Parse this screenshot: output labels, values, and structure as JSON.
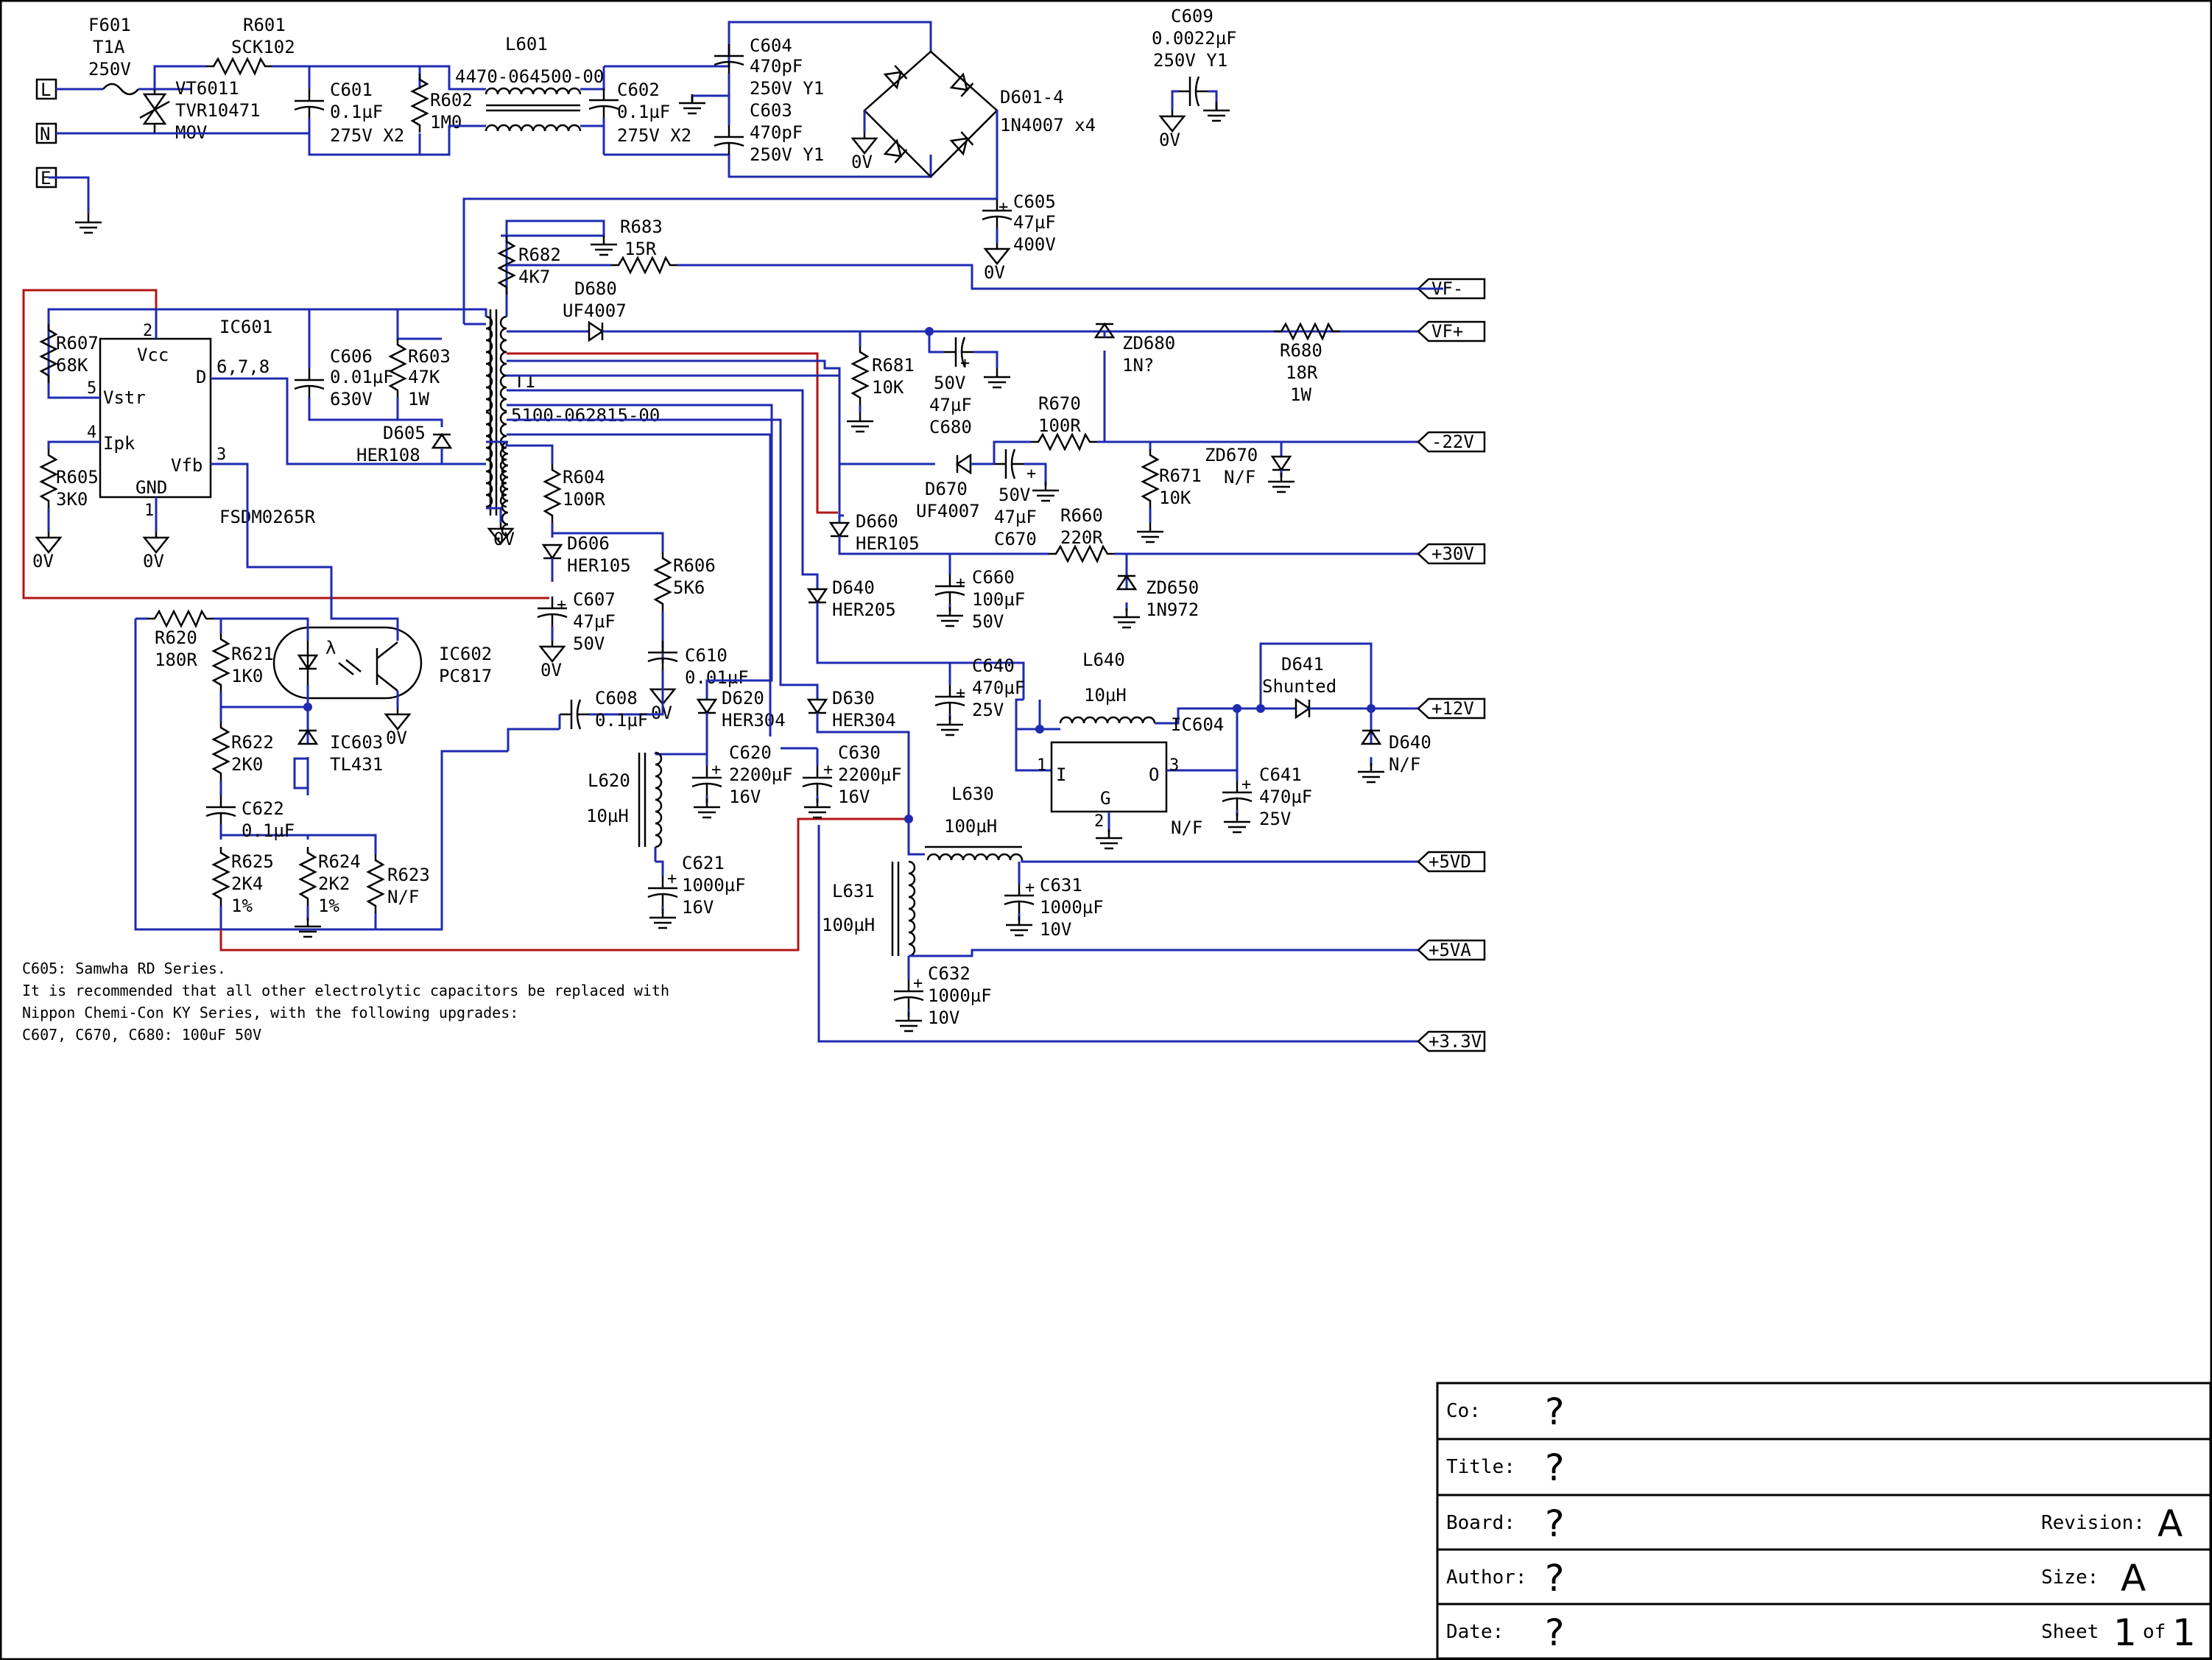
{
  "labels": {
    "f601": "F601",
    "f601_r": "T1A",
    "f601_v": "250V",
    "r601": "R601",
    "r601_v": "SCK102",
    "vt6011": "VT6011",
    "vt_type": "TVR10471",
    "vt_mov": "MOV",
    "c601": "C601",
    "c601_v": "0.1µF",
    "c601_r": "275V  X2",
    "r602": "R602",
    "r602_v": "1M0",
    "l601": "L601",
    "l601_pn": "4470-064500-00",
    "c602": "C602",
    "c602_v": "0.1µF",
    "c602_r": "275V  X2",
    "c604": "C604",
    "c604_v": "470pF",
    "c604_r": "250V  Y1",
    "c603": "C603",
    "c603_v": "470pF",
    "c603_r": "250V  Y1",
    "d601": "D601-4",
    "d601_v": "1N4007  x4",
    "c609": "C609",
    "c609_v": "0.0022µF",
    "c609_r": "250V  Y1",
    "c605": "C605",
    "c605_v": "47µF",
    "c605_r": "400V",
    "r683": "R683",
    "r683_v": "15R",
    "r682": "R682",
    "r682_v": "4K7",
    "d680": "D680",
    "d680_v": "UF4007",
    "ic601": "IC601",
    "ic601_type": "FSDM0265R",
    "pin_vcc": "Vcc",
    "pin_vstr": "Vstr",
    "pin_ipk": "Ipk",
    "pin_vfb": "Vfb",
    "pin_gnd": "GND",
    "pin_d": "D",
    "pin2": "2",
    "pin5": "5",
    "pin4": "4",
    "pin3": "3",
    "pin1": "1",
    "pin678": "6,7,8",
    "r607": "R607",
    "r607_v": "68K",
    "r605": "R605",
    "r605_v": "3K0",
    "c606": "C606",
    "c606_v": "0.01µF",
    "c606_r": "630V",
    "r603": "R603",
    "r603_v": "47K",
    "r603_r": "1W",
    "d605": "D605",
    "d605_v": "HER108",
    "t1": "T1",
    "t1_pn": "5100-062815-00",
    "r681": "R681",
    "r681_v": "10K",
    "c680": "C680",
    "c680_v": "47µF",
    "c680_r": "50V",
    "zd680": "ZD680",
    "zd680_v": "1N?",
    "r680": "R680",
    "r680_v": "18R",
    "r680_r": "1W",
    "r670": "R670",
    "r670_v": "100R",
    "d670": "D670",
    "d670_v": "UF4007",
    "c670": "C670",
    "c670_v": "47µF",
    "c670_r": "50V",
    "r671": "R671",
    "r671_v": "10K",
    "zd670": "ZD670",
    "zd670_v": "N/F",
    "r604": "R604",
    "r604_v": "100R",
    "d606": "D606",
    "d606_v": "HER105",
    "r606": "R606",
    "r606_v": "5K6",
    "c607": "C607",
    "c607_v": "47µF",
    "c607_r": "50V",
    "d660": "D660",
    "d660_v": "HER105",
    "r660": "R660",
    "r660_v": "220R",
    "d640": "D640",
    "d640_v": "HER205",
    "c660": "C660",
    "c660_v": "100µF",
    "c660_r": "50V",
    "zd650": "ZD650",
    "zd650_v": "1N972",
    "r620": "R620",
    "r620_v": "180R",
    "r621": "R621",
    "r621_v": "1K0",
    "ic602": "IC602",
    "ic602_v": "PC817",
    "c610": "C610",
    "c610_v": "0.01µF",
    "c608": "C608",
    "c608_v": "0.1µF",
    "d620": "D620",
    "d620_v": "HER304",
    "d630": "D630",
    "d630_v": "HER304",
    "c640": "C640",
    "c640_v": "470µF",
    "c640_r": "25V",
    "l640": "L640",
    "l640_v": "10µH",
    "d641": "D641",
    "d641_v": "Shunted",
    "r622": "R622",
    "r622_v": "2K0",
    "ic603": "IC603",
    "ic603_v": "TL431",
    "c620": "C620",
    "c620_v": "2200µF",
    "c620_r": "16V",
    "c630": "C630",
    "c630_v": "2200µF",
    "c630_r": "16V",
    "ic604": "IC604",
    "ic604_i": "I",
    "ic604_o": "O",
    "ic604_g": "G",
    "ic604_nf": "N/F",
    "ic604_p1": "1",
    "ic604_p2": "2",
    "ic604_p3": "3",
    "c641": "C641",
    "c641_v": "470µF",
    "c641_r": "25V",
    "d640b": "D640",
    "d640b_v": "N/F",
    "l620": "L620",
    "l620_v": "10µH",
    "l630": "L630",
    "l630_v": "100µH",
    "c622": "C622",
    "c622_v": "0.1µF",
    "r625": "R625",
    "r625_v": "2K4",
    "r625_r": "1%",
    "r624": "R624",
    "r624_v": "2K2",
    "r624_r": "1%",
    "r623": "R623",
    "r623_v": "N/F",
    "c621": "C621",
    "c621_v": "1000µF",
    "c621_r": "16V",
    "c631": "C631",
    "c631_v": "1000µF",
    "c631_r": "10V",
    "l631": "L631",
    "l631_v": "100µH",
    "c632": "C632",
    "c632_v": "1000µF",
    "c632_r": "10V",
    "zero_v": "0V"
  },
  "connectors": {
    "L": "L",
    "N": "N",
    "E": "E",
    "vf_minus": "VF-",
    "vf_plus": "VF+",
    "m22v": "-22V",
    "p30v": "+30V",
    "p12v": "+12V",
    "p5vd": "+5VD",
    "p5va": "+5VA",
    "p33v": "+3.3V"
  },
  "notes": [
    "C605: Samwha RD Series.",
    "It is recommended that all other electrolytic capacitors be replaced with",
    "Nippon Chemi-Con KY Series, with the following upgrades:",
    "C607, C670, C680: 100uF 50V"
  ],
  "title_block": {
    "co_label": "Co:",
    "co_value": "?",
    "title_label": "Title:",
    "title_value": "?",
    "board_label": "Board:",
    "board_value": "?",
    "revision_label": "Revision:",
    "revision_value": "A",
    "author_label": "Author:",
    "author_value": "?",
    "size_label": "Size:",
    "size_value": "A",
    "date_label": "Date:",
    "date_value": "?",
    "sheet_label": "Sheet",
    "sheet_value": "1",
    "sheet_of": "of",
    "sheet_total": "1"
  },
  "colors": {
    "wire": "#1f2bb0",
    "highlight": "#b01616",
    "ink": "#000000"
  }
}
